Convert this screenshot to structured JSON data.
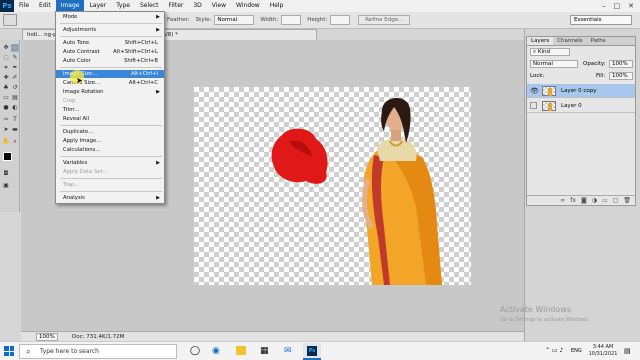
{
  "menubar": {
    "logo": "Ps",
    "items": [
      "File",
      "Edit",
      "Image",
      "Layer",
      "Type",
      "Select",
      "Filter",
      "3D",
      "View",
      "Window",
      "Help"
    ],
    "active_index": 2,
    "window_controls": [
      "–",
      "□",
      "✕"
    ]
  },
  "options_bar": {
    "feather_label": "Feather:",
    "style_label": "Style:",
    "style_value": "Normal",
    "width_label": "Width:",
    "height_label": "Height:",
    "refine_edge": "Refine Edge...",
    "workspace": "Essentials"
  },
  "document": {
    "tab_title": "Indi... ng-preview.png @ 100% (Layer 0 copy, RGB/8) *",
    "zoom": "100%",
    "doc_info": "Doc: 731.4K/1.72M"
  },
  "image_menu": {
    "items": [
      {
        "label": "Mode",
        "submenu": true
      },
      {
        "label": "Adjustments",
        "submenu": true
      },
      {
        "label": "Auto Tone",
        "shortcut": "Shift+Ctrl+L"
      },
      {
        "label": "Auto Contrast",
        "shortcut": "Alt+Shift+Ctrl+L"
      },
      {
        "label": "Auto Color",
        "shortcut": "Shift+Ctrl+B"
      },
      {
        "label": "Image Size...",
        "shortcut": "Alt+Ctrl+I",
        "highlighted": true
      },
      {
        "label": "Canvas Size...",
        "shortcut": "Alt+Ctrl+C"
      },
      {
        "label": "Image Rotation",
        "submenu": true
      },
      {
        "label": "Crop",
        "disabled": true
      },
      {
        "label": "Trim..."
      },
      {
        "label": "Reveal All"
      },
      {
        "label": "Duplicate..."
      },
      {
        "label": "Apply Image..."
      },
      {
        "label": "Calculations..."
      },
      {
        "label": "Variables",
        "submenu": true
      },
      {
        "label": "Apply Data Set...",
        "disabled": true
      },
      {
        "label": "Trap...",
        "disabled": true
      },
      {
        "label": "Analysis",
        "submenu": true
      }
    ]
  },
  "layers_panel": {
    "tabs": [
      "Layers",
      "Channels",
      "Paths"
    ],
    "kind": "Kind",
    "blend_mode": "Normal",
    "opacity_label": "Opacity:",
    "opacity": "100%",
    "lock_label": "Lock:",
    "fill_label": "Fill:",
    "fill": "100%",
    "layers": [
      {
        "name": "Layer 0 copy",
        "selected": true,
        "visible": true
      },
      {
        "name": "Layer 0",
        "selected": false,
        "visible": false
      }
    ]
  },
  "taskbar": {
    "search_placeholder": "Type here to search",
    "time": "3:44 AM",
    "date": "10/31/2021",
    "lang": "ENG"
  },
  "watermark": {
    "line1": "Activate Windows",
    "line2": "Go to Settings to activate Windows."
  },
  "colors": {
    "accent": "#1e6fbf",
    "highlight": "#3a86d8",
    "ps_blue": "#31a8ff"
  }
}
